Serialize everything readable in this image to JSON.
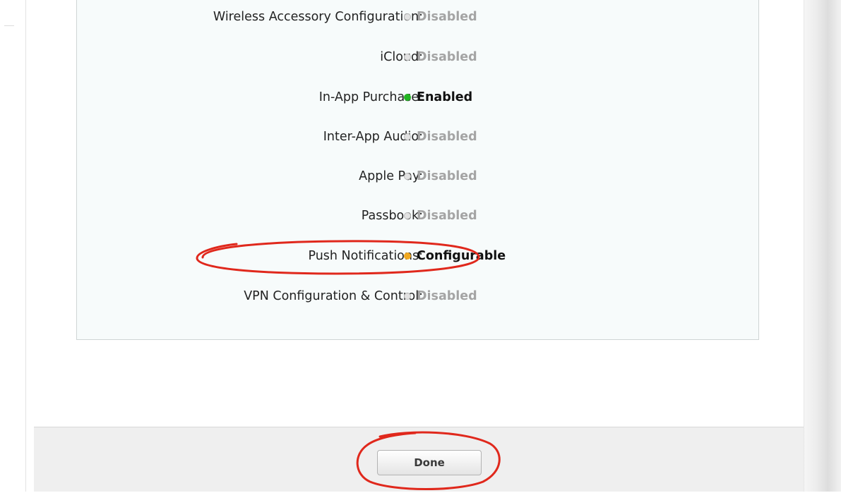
{
  "capabilities": [
    {
      "label": "Wireless Accessory Configuration:",
      "status": "Disabled",
      "state": "disabled"
    },
    {
      "label": "iCloud:",
      "status": "Disabled",
      "state": "disabled"
    },
    {
      "label": "In-App Purchase:",
      "status": "Enabled",
      "state": "enabled"
    },
    {
      "label": "Inter-App Audio:",
      "status": "Disabled",
      "state": "disabled"
    },
    {
      "label": "Apple Pay:",
      "status": "Disabled",
      "state": "disabled"
    },
    {
      "label": "Passbook:",
      "status": "Disabled",
      "state": "disabled"
    },
    {
      "label": "Push Notifications:",
      "status": "Configurable",
      "state": "configurable"
    },
    {
      "label": "VPN Configuration & Control:",
      "status": "Disabled",
      "state": "disabled"
    }
  ],
  "footer": {
    "done_label": "Done"
  },
  "colors": {
    "enabled_dot": "#22b422",
    "configurable_dot": "#f0a820",
    "disabled_dot": "#e2e2e2",
    "annotation_circle": "#e0281c"
  }
}
